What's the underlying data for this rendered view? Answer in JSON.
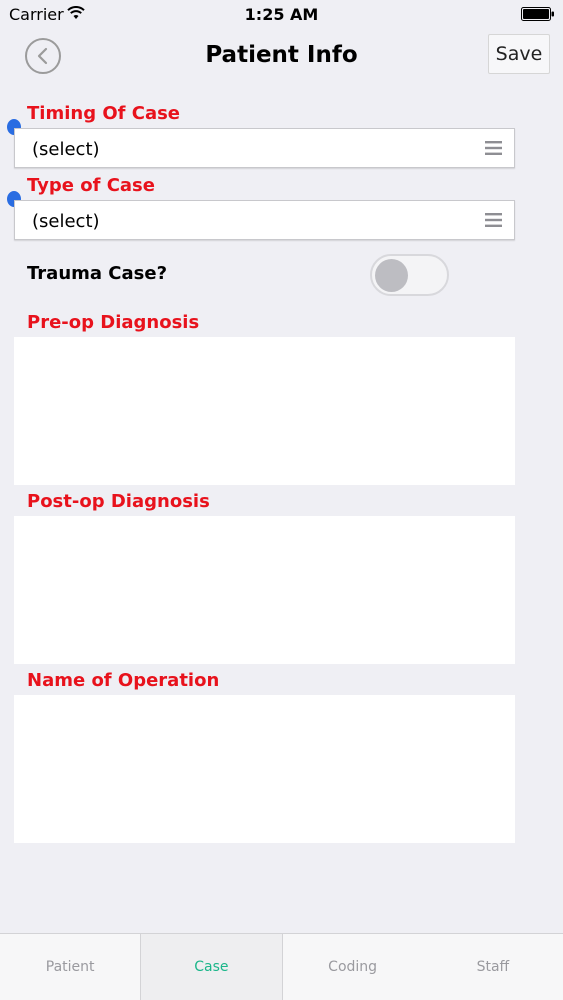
{
  "status_bar": {
    "carrier": "Carrier",
    "time": "1:25 AM"
  },
  "nav": {
    "title": "Patient Info",
    "save_label": "Save"
  },
  "form": {
    "timing_label": "Timing Of Case",
    "timing_value": "(select)",
    "type_label": "Type of Case",
    "type_value": "(select)",
    "trauma_label": "Trauma Case?",
    "trauma_on": false,
    "preop_label": "Pre-op Diagnosis",
    "postop_label": "Post-op Diagnosis",
    "operation_label": "Name of Operation"
  },
  "tabs": [
    {
      "label": "Patient",
      "active": false
    },
    {
      "label": "Case",
      "active": true
    },
    {
      "label": "Coding",
      "active": false
    },
    {
      "label": "Staff",
      "active": false
    }
  ],
  "colors": {
    "label_red": "#e8121c",
    "accent_green": "#1bb68a",
    "required_blue": "#2a6de2"
  },
  "icons": {
    "back": "chevron-left-icon",
    "select_menu": "menu-lines-icon"
  }
}
